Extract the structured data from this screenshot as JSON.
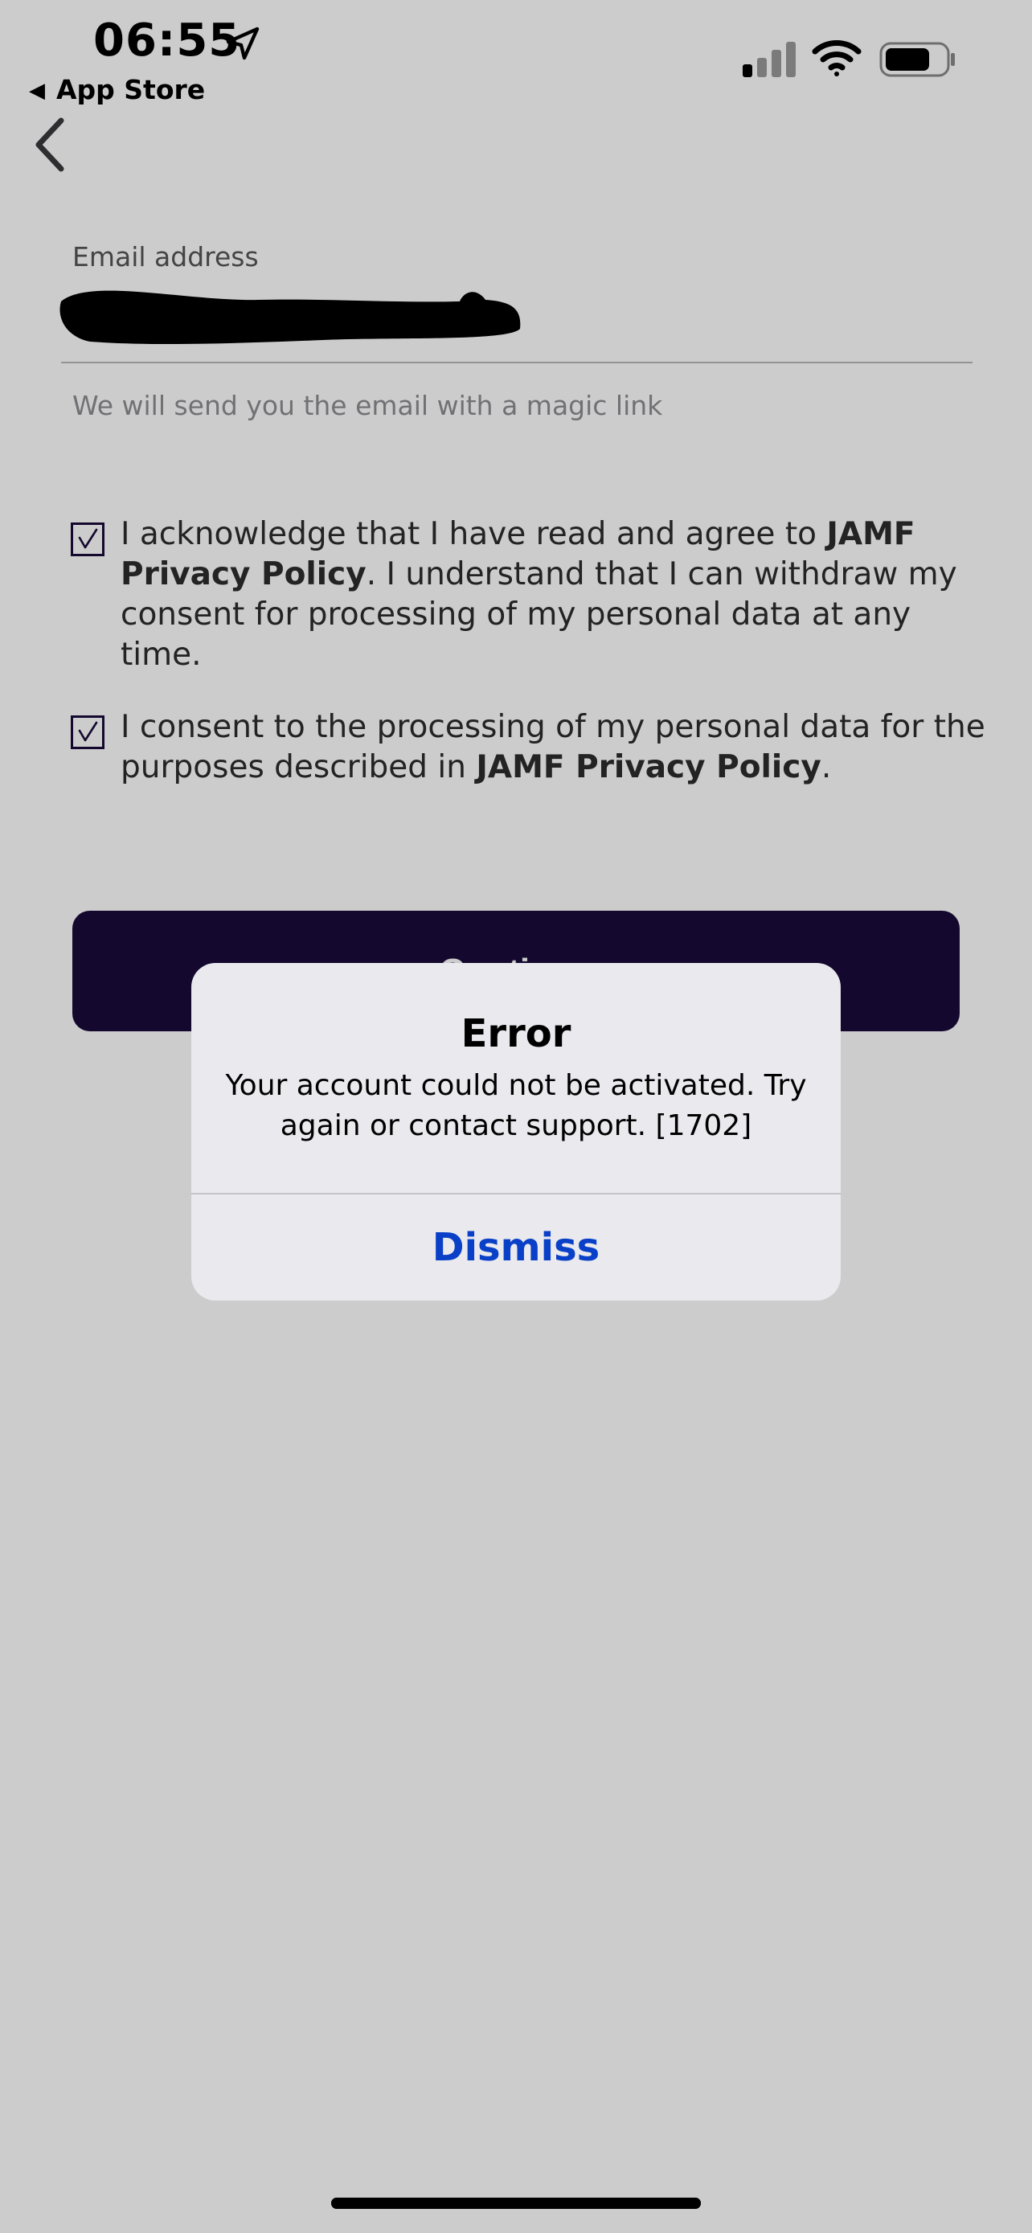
{
  "status_bar": {
    "time": "06:55",
    "back_to_app": "App Store",
    "icons": [
      "location-arrow-icon",
      "cellular-signal-icon",
      "wifi-icon",
      "battery-icon"
    ]
  },
  "nav": {
    "back_icon": "chevron-left-icon"
  },
  "email": {
    "label": "Email address",
    "value_redacted": true,
    "helper": "We will send you the email with a magic link"
  },
  "consents": [
    {
      "checked": true,
      "text_before": "I acknowledge that I have read and agree to ",
      "link": "JAMF Privacy Policy",
      "text_after": ". I understand that I can withdraw my consent for processing of my personal data at any time."
    },
    {
      "checked": true,
      "text_before": "I consent to the processing of my personal data for the purposes described in ",
      "link": "JAMF Privacy Policy",
      "text_after": "."
    }
  ],
  "continue_button": {
    "label": "Continue"
  },
  "alert": {
    "title": "Error",
    "message": "Your account could not be activated. Try again or contact support. [1702]",
    "dismiss_label": "Dismiss"
  },
  "colors": {
    "accent_dark": "#1a0a3a",
    "alert_link": "#0a40c8",
    "dim_overlay": "rgba(0,0,0,0.2)"
  }
}
